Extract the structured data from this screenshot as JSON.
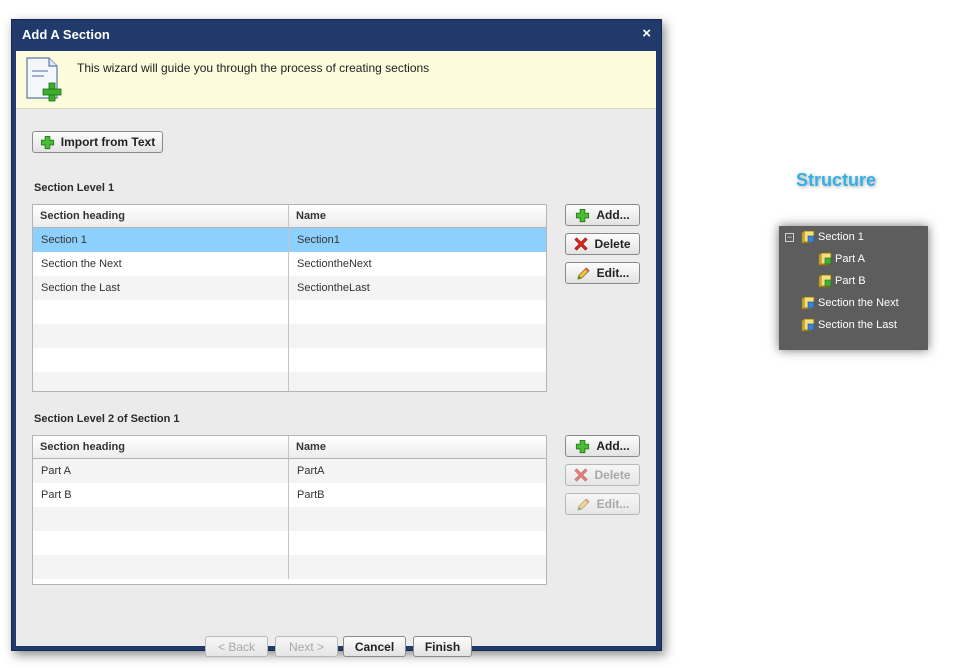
{
  "dialog": {
    "title": "Add A Section",
    "close_glyph": "×",
    "banner_text": "This wizard will guide you through the process of creating sections"
  },
  "toolbar": {
    "import_label": "Import from Text"
  },
  "level1": {
    "label": "Section Level 1",
    "columns": [
      "Section heading",
      "Name"
    ],
    "rows": [
      {
        "heading": "Section 1",
        "name": "Section1",
        "selected": true
      },
      {
        "heading": "Section the Next",
        "name": "SectiontheNext",
        "selected": false
      },
      {
        "heading": "Section the Last",
        "name": "SectiontheLast",
        "selected": false
      }
    ],
    "buttons": {
      "add": "Add...",
      "delete": "Delete",
      "edit": "Edit..."
    }
  },
  "level2": {
    "label": "Section Level 2 of Section 1",
    "columns": [
      "Section heading",
      "Name"
    ],
    "rows": [
      {
        "heading": "Part A",
        "name": "PartA"
      },
      {
        "heading": "Part B",
        "name": "PartB"
      }
    ],
    "buttons": {
      "add": "Add...",
      "delete": "Delete",
      "edit": "Edit..."
    },
    "delete_enabled": false,
    "edit_enabled": false
  },
  "footer": {
    "back_label": "< Back",
    "next_label": "Next >",
    "cancel_label": "Cancel",
    "finish_label": "Finish"
  },
  "structure": {
    "title": "Structure",
    "items": [
      {
        "label": "Section 1",
        "collapse_glyph": "−"
      },
      {
        "label": "Part A"
      },
      {
        "label": "Part B"
      },
      {
        "label": "Section the Next"
      },
      {
        "label": "Section the Last"
      }
    ]
  },
  "icons": {
    "add": "plus-icon",
    "delete": "red-x-icon",
    "edit": "pencil-icon",
    "tree_node": "section-node-icon"
  },
  "colors": {
    "title_bar": "#1f3a6b",
    "banner": "#fcfbdc",
    "selected_row": "#8dd0fd",
    "structure_title": "#33b0e6",
    "tree_bg": "#5d5d5d"
  }
}
